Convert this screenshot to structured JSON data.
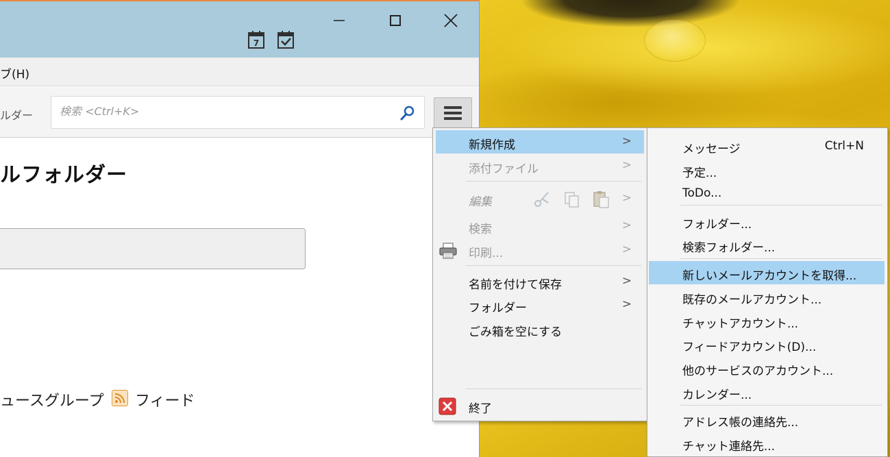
{
  "window": {
    "help_menu": "ブ(H)",
    "folder_crumb": "ルダー",
    "search_placeholder": "検索 <Ctrl+K>",
    "page_title": "ルフォルダー",
    "newsgroup_link": "ュースグループ",
    "feed_link": "フィード"
  },
  "main_menu": {
    "items": [
      {
        "label": "新規作成",
        "has_submenu": true,
        "enabled": true,
        "highlighted": true
      },
      {
        "label": "添付ファイル",
        "has_submenu": true,
        "enabled": false
      },
      {
        "label": "編集",
        "has_submenu": true,
        "enabled": false
      },
      {
        "label": "検索",
        "has_submenu": true,
        "enabled": false
      },
      {
        "label": "印刷...",
        "has_submenu": true,
        "enabled": false
      },
      {
        "label": "名前を付けて保存",
        "has_submenu": true,
        "enabled": true
      },
      {
        "label": "フォルダー",
        "has_submenu": true,
        "enabled": true
      },
      {
        "label": "ごみ箱を空にする",
        "has_submenu": false,
        "enabled": true
      },
      {
        "label": "終了",
        "has_submenu": false,
        "enabled": true
      }
    ],
    "arrow": ">"
  },
  "sub_menu": {
    "items": [
      {
        "label": "メッセージ",
        "shortcut": "Ctrl+N"
      },
      {
        "label": "予定..."
      },
      {
        "label": "ToDo..."
      },
      {
        "label": "フォルダー..."
      },
      {
        "label": "検索フォルダー..."
      },
      {
        "label": "新しいメールアカウントを取得...",
        "highlighted": true
      },
      {
        "label": "既存のメールアカウント..."
      },
      {
        "label": "チャットアカウント..."
      },
      {
        "label": "フィードアカウント(D)..."
      },
      {
        "label": "他のサービスのアカウント..."
      },
      {
        "label": "カレンダー..."
      },
      {
        "label": "アドレス帳の連絡先..."
      },
      {
        "label": "チャット連絡先..."
      }
    ]
  },
  "colors": {
    "titlebar": "#a9cbdc",
    "highlight": "#a7d3f3",
    "accent_border": "#e8893a"
  }
}
